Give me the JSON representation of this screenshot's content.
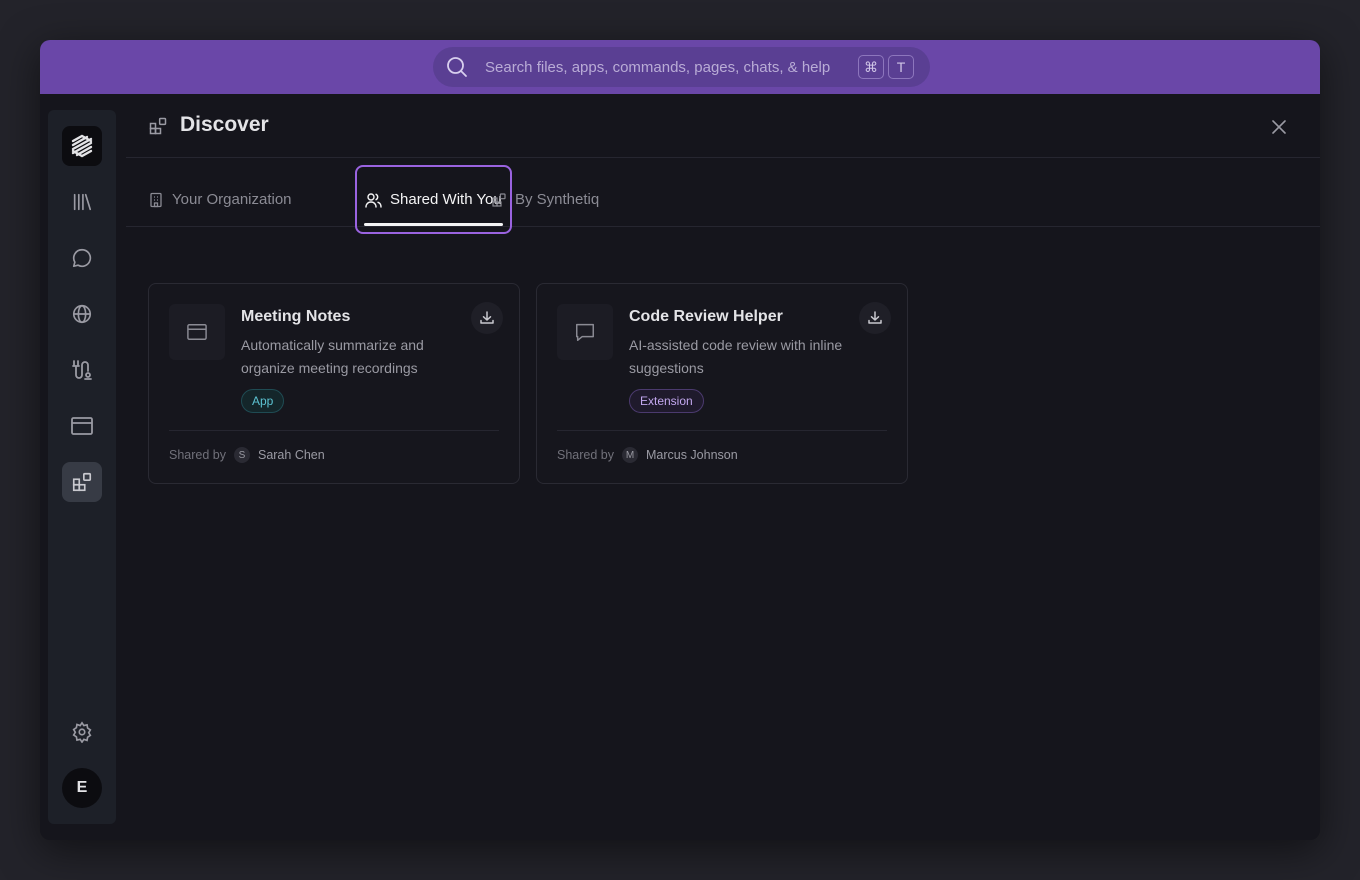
{
  "search": {
    "placeholder": "Search files, apps, commands, pages, chats, & help",
    "shortcut_keys": [
      "⌘",
      "T"
    ]
  },
  "sidebar": {
    "items": [
      {
        "name": "logo",
        "icon": "stripes-logo-icon"
      },
      {
        "name": "library",
        "icon": "library-icon"
      },
      {
        "name": "chats",
        "icon": "chat-bubble-icon"
      },
      {
        "name": "web",
        "icon": "globe-icon"
      },
      {
        "name": "tools",
        "icon": "tools-icon"
      },
      {
        "name": "browser",
        "icon": "window-icon"
      },
      {
        "name": "discover",
        "icon": "grid-plus-icon",
        "active": true
      },
      {
        "name": "settings",
        "icon": "gear-icon"
      }
    ],
    "avatar_initial": "E"
  },
  "header": {
    "title": "Discover"
  },
  "tabs": [
    {
      "label": "Your Organization",
      "icon": "building-icon",
      "active": false
    },
    {
      "label": "Shared With You",
      "icon": "users-icon",
      "active": true
    },
    {
      "label": "By Synthetiq",
      "icon": "grid-plus-icon",
      "active": false
    }
  ],
  "cards": [
    {
      "title": "Meeting Notes",
      "description": "Automatically summarize and organize meeting recordings",
      "badge": "App",
      "shared_by_label": "Shared by",
      "sharer_initial": "S",
      "sharer_name": "Sarah Chen",
      "icon": "window-icon"
    },
    {
      "title": "Code Review Helper",
      "description": "AI-assisted code review with inline suggestions",
      "badge": "Extension",
      "shared_by_label": "Shared by",
      "sharer_initial": "M",
      "sharer_name": "Marcus Johnson",
      "icon": "chat-bubble-icon"
    }
  ],
  "colors": {
    "topbar": "#6a47a8",
    "accent": "#9a63e0",
    "background": "#15151c"
  }
}
